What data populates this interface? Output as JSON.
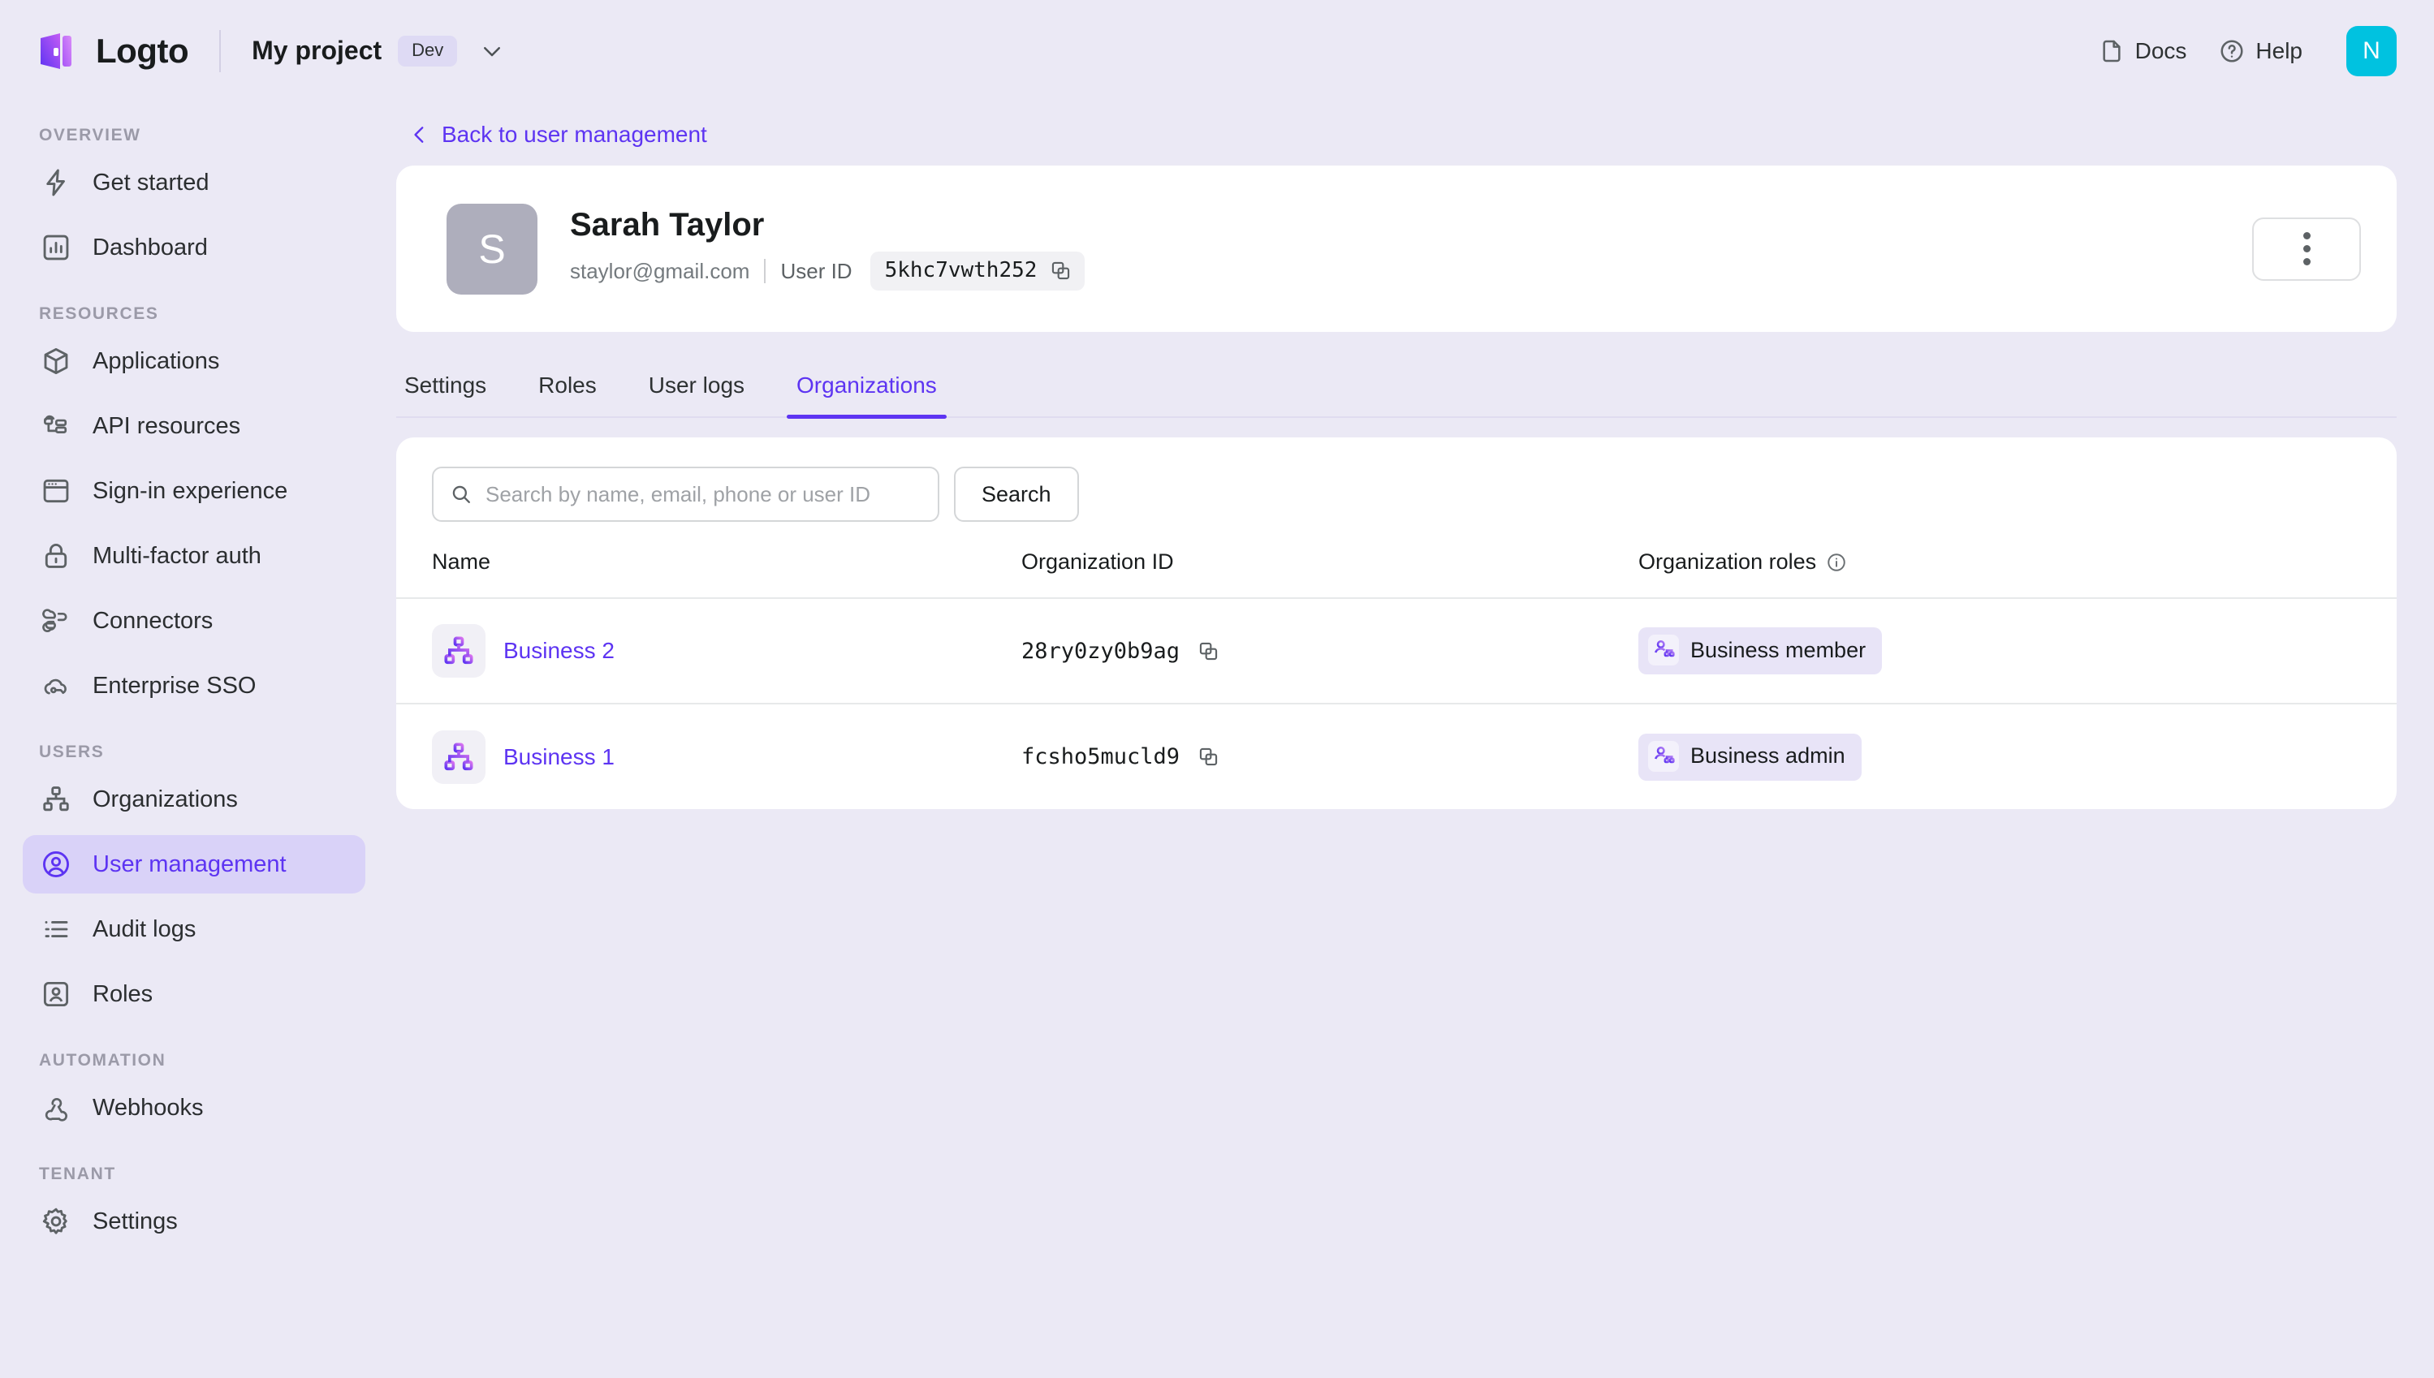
{
  "topbar": {
    "brand_name": "Logto",
    "project_name": "My project",
    "env_badge": "Dev",
    "docs_label": "Docs",
    "help_label": "Help",
    "avatar_initial": "N"
  },
  "sidebar": {
    "sections": [
      {
        "title": "OVERVIEW",
        "items": [
          {
            "label": "Get started",
            "icon": "bolt-icon",
            "active": false
          },
          {
            "label": "Dashboard",
            "icon": "bar-chart-icon",
            "active": false
          }
        ]
      },
      {
        "title": "RESOURCES",
        "items": [
          {
            "label": "Applications",
            "icon": "cube-icon",
            "active": false
          },
          {
            "label": "API resources",
            "icon": "api-resources-icon",
            "active": false
          },
          {
            "label": "Sign-in experience",
            "icon": "browser-window-icon",
            "active": false
          },
          {
            "label": "Multi-factor auth",
            "icon": "lock-icon",
            "active": false
          },
          {
            "label": "Connectors",
            "icon": "connectors-icon",
            "active": false
          },
          {
            "label": "Enterprise SSO",
            "icon": "cloud-key-icon",
            "active": false
          }
        ]
      },
      {
        "title": "USERS",
        "items": [
          {
            "label": "Organizations",
            "icon": "org-tree-icon",
            "active": false
          },
          {
            "label": "User management",
            "icon": "user-circle-icon",
            "active": true
          },
          {
            "label": "Audit logs",
            "icon": "list-icon",
            "active": false
          },
          {
            "label": "Roles",
            "icon": "user-badge-icon",
            "active": false
          }
        ]
      },
      {
        "title": "AUTOMATION",
        "items": [
          {
            "label": "Webhooks",
            "icon": "webhook-icon",
            "active": false
          }
        ]
      },
      {
        "title": "TENANT",
        "items": [
          {
            "label": "Settings",
            "icon": "gear-icon",
            "active": false
          }
        ]
      }
    ]
  },
  "main": {
    "back_link": "Back to user management",
    "user": {
      "avatar_initial": "S",
      "name": "Sarah Taylor",
      "email": "staylor@gmail.com",
      "user_id_label": "User ID",
      "user_id_value": "5khc7vwth252"
    },
    "tabs": [
      {
        "label": "Settings",
        "active": false
      },
      {
        "label": "Roles",
        "active": false
      },
      {
        "label": "User logs",
        "active": false
      },
      {
        "label": "Organizations",
        "active": true
      }
    ],
    "search": {
      "placeholder": "Search by name, email, phone or user ID",
      "value": "",
      "button_label": "Search"
    },
    "table": {
      "columns": {
        "name": "Name",
        "organization_id": "Organization ID",
        "organization_roles": "Organization roles"
      },
      "rows": [
        {
          "name": "Business 2",
          "organization_id": "28ry0zy0b9ag",
          "role": "Business member"
        },
        {
          "name": "Business 1",
          "organization_id": "fcsho5mucld9",
          "role": "Business admin"
        }
      ]
    }
  },
  "colors": {
    "page_bg": "#ebe9f5",
    "accent": "#5d34f2",
    "card_bg": "#ffffff",
    "active_nav_bg": "#d9d2f8",
    "avatar_teal": "#00c2e0",
    "user_avatar_gray": "#aeaebc"
  }
}
